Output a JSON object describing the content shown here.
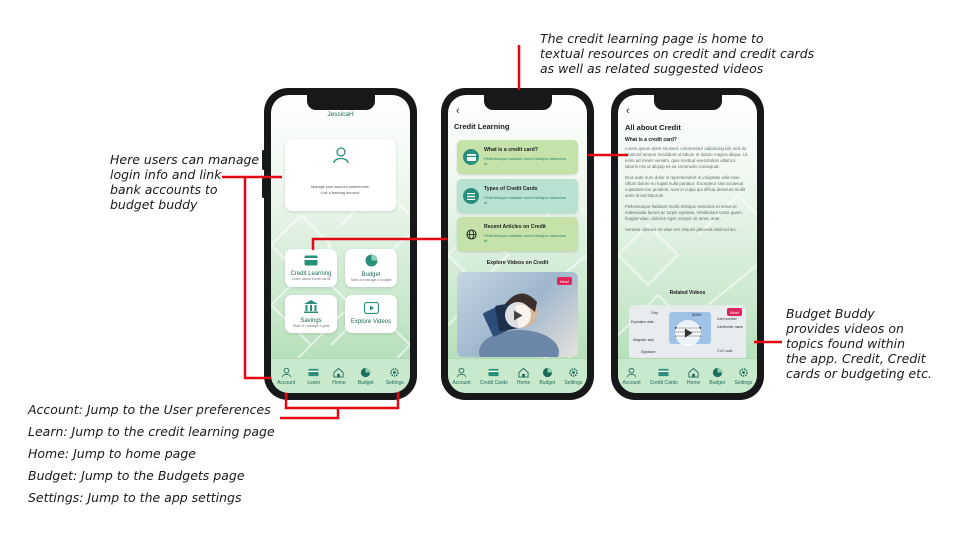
{
  "annotations": {
    "left_manage": [
      "Here users can manage",
      "login info and link",
      "bank accounts to",
      "budget buddy"
    ],
    "top_credit": [
      "The credit learning page is home to",
      "textual resources on credit and credit cards",
      "as well as related suggested videos"
    ],
    "right_videos": [
      "Budget Buddy",
      "provides videos on",
      "topics found within",
      "the app. Credit, Credit",
      "cards or budgeting etc."
    ]
  },
  "legend": [
    "Account: Jump to the User preferences",
    "Learn: Jump to the credit learning page",
    "Home: Jump to home page",
    "Budget: Jump to the Budgets page",
    "Settings: Jump to the app settings"
  ],
  "nav": {
    "account": "Account",
    "learn": "Learn",
    "home": "Home",
    "budget": "Budget",
    "settings": "Settings",
    "credit_cards": "Credit Cards"
  },
  "phone1": {
    "username": "JessicaH",
    "profile_lines": [
      "Manage your account preferences.",
      "Link a banking account."
    ],
    "tiles": {
      "credit_learning": {
        "title": "Credit Learning",
        "sub": "Learn about credit cards"
      },
      "budget": {
        "title": "Budget",
        "sub": "Start or manage a budget"
      },
      "savings": {
        "title": "Savings",
        "sub": "Start or manage a goal"
      },
      "explore": {
        "title": "Explore Videos"
      }
    }
  },
  "phone2": {
    "back": "‹",
    "title": "Credit Learning",
    "cards": [
      {
        "title": "What is a credit card?",
        "sub": "Pellentesque habitant morbi tristique senectus et"
      },
      {
        "title": "Types of Credit Cards",
        "sub": "Pellentesque habitant morbi tristique senectus et"
      },
      {
        "title": "Recent Articles on Credit",
        "sub": "Pellentesque habitant morbi tristique senectus et"
      }
    ],
    "videos_heading": "Explore Videos on Credit",
    "new_badge": "New!"
  },
  "phone3": {
    "back": "‹",
    "title": "All about Credit",
    "subtitle": "What is a credit card?",
    "paragraphs": [
      "Lorem ipsum dolor sit amet, consectetur adipiscing elit, sed do eiusmod tempor incididunt ut labore et dolore magna aliqua. Ut enim ad minim veniam, quis nostrud exercitation ullamco laboris nisi ut aliquip ex ea commodo consequat.",
      "Duis aute irure dolor in reprehenderit in voluptate velit esse cillum dolore eu fugiat nulla pariatur. Excepteur sint occaecat cupidatat non proident, sunt in culpa qui officia deserunt mollit anim id est laborum.",
      "Pellentesque habitant morbi tristique senectus et netus et malesuada fames ac turpis egestas. Vestibulum tortor quam, feugiat vitae, ultricies eget, tempor sit amet, ante.",
      "Aenean ultricies mi vitae est. Mauris placerat eleifend leo."
    ],
    "related": "Related Videos",
    "new_badge": "New!",
    "diagram_labels": [
      "Chip",
      "Expiration date",
      "Magnetic strip",
      "Signature",
      "Card number",
      "Cardholder name",
      "CVC code",
      "$2000"
    ]
  },
  "colors": {
    "accent": "#1f6b5b",
    "red": "#e30613",
    "badge": "#e0245e"
  }
}
